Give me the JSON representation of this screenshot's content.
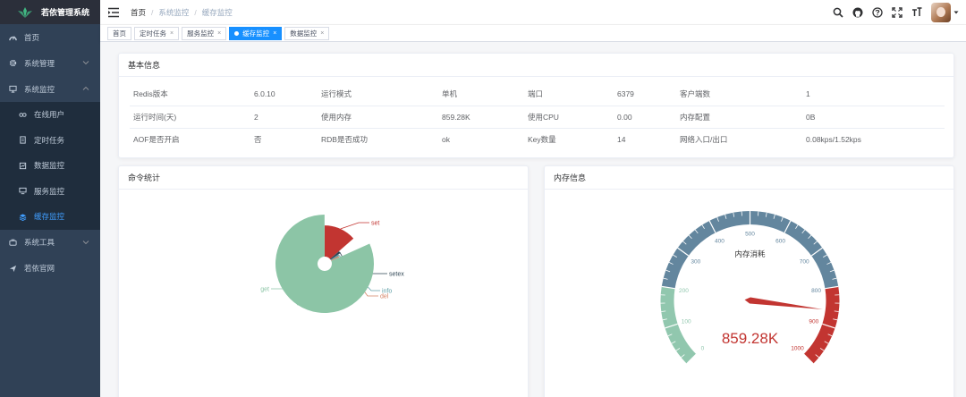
{
  "app": {
    "title": "若依管理系统"
  },
  "sidebar": {
    "items": [
      {
        "label": "首页",
        "icon": "dashboard-icon"
      },
      {
        "label": "系统管理",
        "icon": "gear-icon",
        "expandable": true
      },
      {
        "label": "系统监控",
        "icon": "monitor-icon",
        "expandable": true,
        "expanded": true,
        "children": [
          {
            "label": "在线用户",
            "icon": "online-icon"
          },
          {
            "label": "定时任务",
            "icon": "job-icon"
          },
          {
            "label": "数据监控",
            "icon": "druid-icon"
          },
          {
            "label": "服务监控",
            "icon": "server-icon"
          },
          {
            "label": "缓存监控",
            "icon": "redis-icon",
            "active": true
          }
        ]
      },
      {
        "label": "系统工具",
        "icon": "tool-icon",
        "expandable": true
      },
      {
        "label": "若依官网",
        "icon": "guide-icon"
      }
    ]
  },
  "navbar": {
    "breadcrumb": [
      "首页",
      "系统监控",
      "缓存监控"
    ]
  },
  "tags": [
    {
      "label": "首页",
      "closable": false
    },
    {
      "label": "定时任务",
      "closable": true
    },
    {
      "label": "服务监控",
      "closable": true
    },
    {
      "label": "缓存监控",
      "closable": true,
      "active": true
    },
    {
      "label": "数据监控",
      "closable": true
    }
  ],
  "info": {
    "title": "基本信息",
    "rows": [
      [
        [
          "Redis版本",
          "6.0.10"
        ],
        [
          "运行模式",
          "单机"
        ],
        [
          "端口",
          "6379"
        ],
        [
          "客户端数",
          "1"
        ]
      ],
      [
        [
          "运行时间(天)",
          "2"
        ],
        [
          "使用内存",
          "859.28K"
        ],
        [
          "使用CPU",
          "0.00"
        ],
        [
          "内存配置",
          "0B"
        ]
      ],
      [
        [
          "AOF是否开启",
          "否"
        ],
        [
          "RDB是否成功",
          "ok"
        ],
        [
          "Key数量",
          "14"
        ],
        [
          "网络入口/出口",
          "0.08kps/1.52kps"
        ]
      ]
    ]
  },
  "command_stats": {
    "title": "命令统计"
  },
  "memory_info": {
    "title": "内存信息"
  },
  "chart_data": [
    {
      "type": "pie",
      "rose": true,
      "labels": [
        "get",
        "set",
        "setex",
        "info",
        "del"
      ],
      "values": [
        100,
        55,
        8,
        5,
        4
      ],
      "colors": [
        "#8cc5a6",
        "#c23531",
        "#2f4554",
        "#61a0a8",
        "#d48265"
      ]
    },
    {
      "type": "gauge",
      "title": "内存消耗",
      "min": 0,
      "max": 1000,
      "ticks": [
        0,
        100,
        200,
        300,
        400,
        500,
        600,
        700,
        800,
        900,
        1000
      ],
      "value": 859.28,
      "display_value": "859.28K",
      "bands": [
        {
          "to": 0.2,
          "color": "#91c7ae"
        },
        {
          "to": 0.8,
          "color": "#63869e"
        },
        {
          "to": 1.0,
          "color": "#c23531"
        }
      ]
    }
  ]
}
